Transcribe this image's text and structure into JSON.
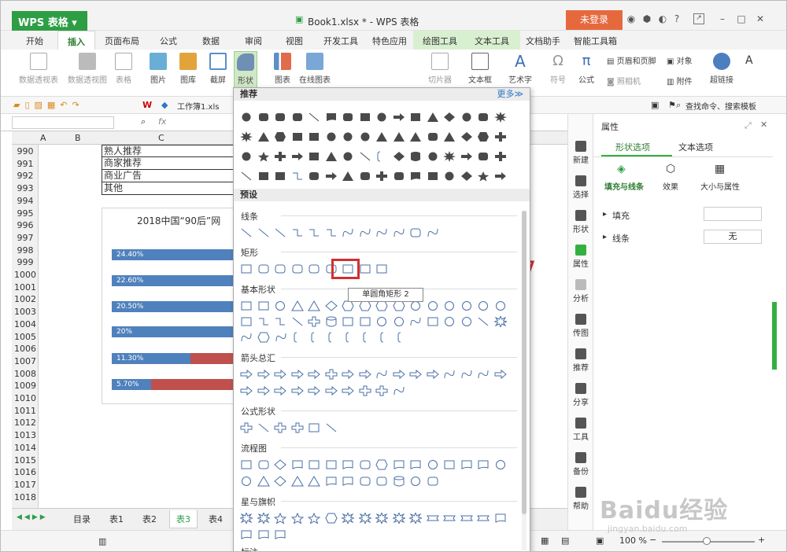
{
  "app": {
    "wps_label": "WPS 表格",
    "doc_title": "Book1.xlsx * - WPS 表格",
    "login": "未登录",
    "help": "?"
  },
  "menu": [
    "开始",
    "插入",
    "页面布局",
    "公式",
    "数据",
    "审阅",
    "视图",
    "开发工具",
    "特色应用",
    "绘图工具",
    "文本工具",
    "文档助手",
    "智能工具箱"
  ],
  "ribbon": [
    "数据透视表",
    "数据透视图",
    "表格",
    "图片",
    "图库",
    "截屏",
    "形状",
    "图表",
    "在线图表",
    "切片器",
    "文本框",
    "艺术字",
    "符号",
    "公式",
    "页眉和页脚",
    "对象",
    "照相机",
    "附件",
    "超链接"
  ],
  "quickbar": {
    "doc_tab": "工作簿1.xls",
    "search": "查找命令、搜索模板"
  },
  "formula": {
    "fx": "fx"
  },
  "columns": [
    "A",
    "B",
    "C"
  ],
  "rows": [
    "990",
    "991",
    "992",
    "993",
    "994",
    "995",
    "996",
    "997",
    "998",
    "999",
    "1000",
    "1001",
    "1002",
    "1003",
    "1004",
    "1005",
    "1006",
    "1007",
    "1008",
    "1009",
    "1010",
    "1011",
    "1012",
    "1013",
    "1014",
    "1015",
    "1016",
    "1017",
    "1018"
  ],
  "cells": [
    "熟人推荐",
    "商家推荐",
    "商业广告",
    "其他"
  ],
  "chart": {
    "title": "2018中国“90后”网",
    "bars": [
      "24.40%",
      "22.60%",
      "20.50%",
      "20%",
      "11.30%",
      "5.70%"
    ]
  },
  "sheet_tabs": [
    "目录",
    "表1",
    "表2",
    "表3",
    "表4"
  ],
  "status": {
    "zoom": "100 %"
  },
  "panel": {
    "recommend": "推荐",
    "more": "更多≫",
    "preset": "预设",
    "cats": [
      "线条",
      "矩形",
      "基本形状",
      "箭头总汇",
      "公式形状",
      "流程图",
      "星与旗帜",
      "标注"
    ],
    "tooltip": "单圆角矩形 2"
  },
  "sidetools": [
    "新建",
    "选择",
    "形状",
    "属性",
    "分析",
    "传图",
    "推荐",
    "分享",
    "工具",
    "备份",
    "帮助"
  ],
  "props": {
    "title": "属性",
    "tab_shape": "形状选项",
    "tab_text": "文本选项",
    "sub_fill": "填充与线条",
    "sub_effect": "效果",
    "sub_size": "大小与属性",
    "fill": "填充",
    "line": "线条",
    "line_value": "无"
  },
  "watermark": {
    "main": "Baidu经验",
    "sub": "jingyan.baidu.com"
  },
  "colors": {
    "wps_green": "#2e9e45",
    "login_orange": "#e6693e",
    "bar_blue": "#4f81bd",
    "bar_red": "#c0504d",
    "highlight_red": "#d32f2f"
  }
}
